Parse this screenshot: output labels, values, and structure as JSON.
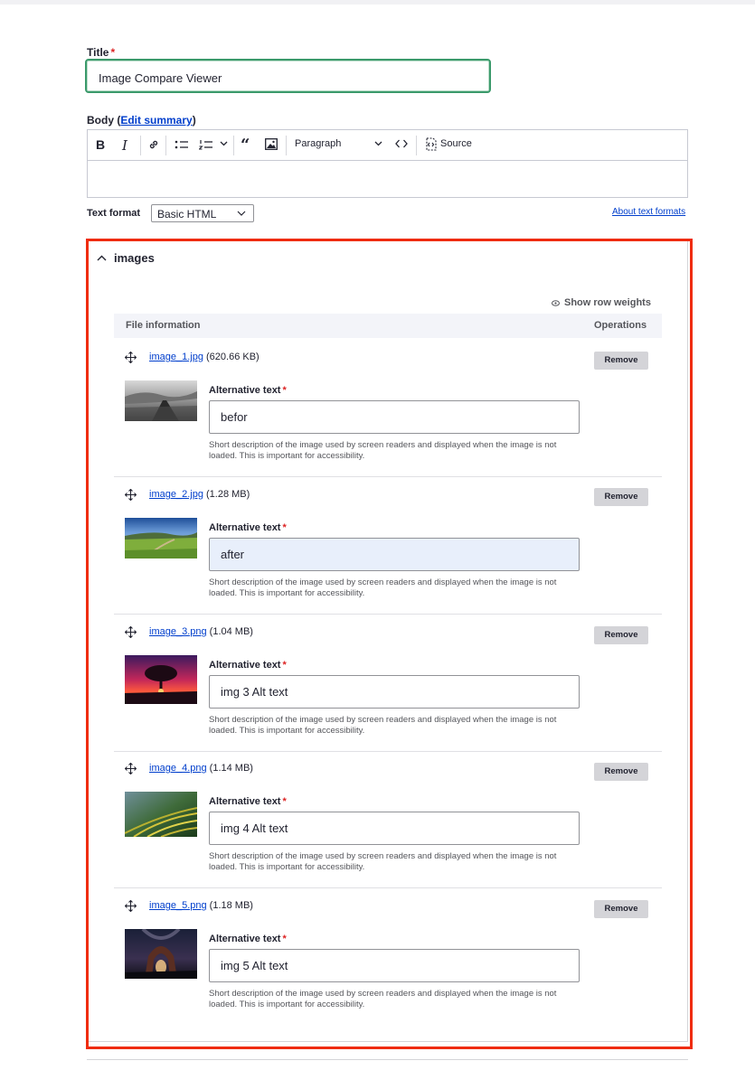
{
  "title_field": {
    "label": "Title",
    "required_mark": "*",
    "value": "Image Compare Viewer"
  },
  "body_field": {
    "label_start": "Body (",
    "edit_summary_link": "Edit summary",
    "label_end": ")",
    "toolbar": {
      "heading_select": "Paragraph",
      "source_label": "Source"
    }
  },
  "text_format": {
    "label": "Text format",
    "selected": "Basic HTML",
    "about_link": "About text formats"
  },
  "images": {
    "summary": "images",
    "show_row_weights": "Show row weights",
    "columns": [
      "File information",
      "Operations"
    ],
    "alt_label": "Alternative text",
    "required_mark": "*",
    "description": "Short description of the image used by screen readers and displayed when the image is not loaded. This is important for accessibility.",
    "remove_label": "Remove",
    "rows": [
      {
        "file": "image_1.jpg",
        "size": "(620.66 KB)",
        "alt": "befor"
      },
      {
        "file": "image_2.jpg",
        "size": "(1.28 MB)",
        "alt": "after"
      },
      {
        "file": "image_3.png",
        "size": "(1.04 MB)",
        "alt": "img 3 Alt text"
      },
      {
        "file": "image_4.png",
        "size": "(1.14 MB)",
        "alt": "img 4 Alt text"
      },
      {
        "file": "image_5.png",
        "size": "(1.18 MB)",
        "alt": "img 5 Alt text"
      }
    ]
  }
}
